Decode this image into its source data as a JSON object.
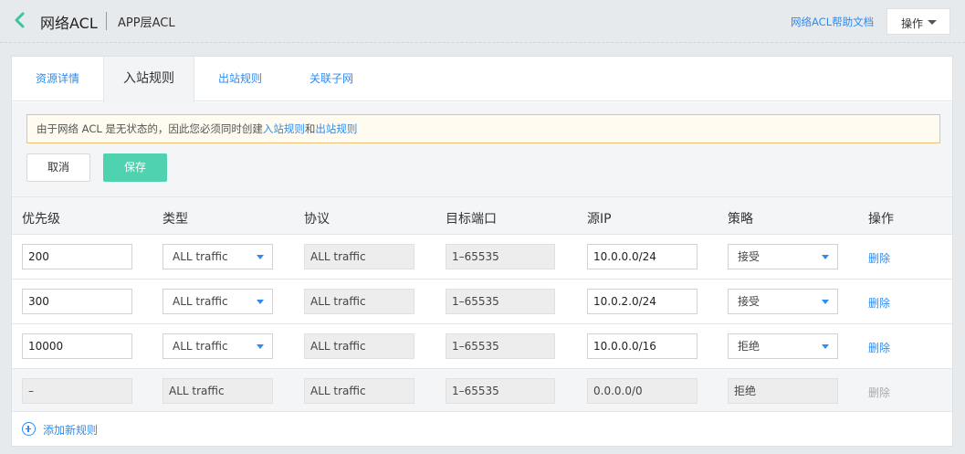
{
  "header": {
    "title": "网络ACL",
    "subtitle": "APP层ACL",
    "help_link": "网络ACL帮助文档",
    "ops_label": "操作"
  },
  "tabs": [
    {
      "label": "资源详情"
    },
    {
      "label": "入站规则"
    },
    {
      "label": "出站规则"
    },
    {
      "label": "关联子网"
    }
  ],
  "active_tab": "入站规则",
  "notice": {
    "prefix": "由于网络 ACL 是无状态的，因此您必须同时创建",
    "link1": "入站规则",
    "middle": "和",
    "link2": "出站规则"
  },
  "buttons": {
    "cancel": "取消",
    "save": "保存"
  },
  "columns": [
    "优先级",
    "类型",
    "协议",
    "目标端口",
    "源IP",
    "策略",
    "操作"
  ],
  "rows": [
    {
      "priority": "200",
      "type": "ALL traffic",
      "protocol": "ALL traffic",
      "port": "1–65535",
      "source_ip": "10.0.0.0/24",
      "policy": "接受",
      "action": "删除"
    },
    {
      "priority": "300",
      "type": "ALL traffic",
      "protocol": "ALL traffic",
      "port": "1–65535",
      "source_ip": "10.0.2.0/24",
      "policy": "接受",
      "action": "删除"
    },
    {
      "priority": "10000",
      "type": "ALL traffic",
      "protocol": "ALL traffic",
      "port": "1–65535",
      "source_ip": "10.0.0.0/16",
      "policy": "拒绝",
      "action": "删除"
    },
    {
      "priority": "–",
      "type": "ALL traffic",
      "protocol": "ALL traffic",
      "port": "1–65535",
      "source_ip": "0.0.0.0/0",
      "policy": "拒绝",
      "action": "删除"
    }
  ],
  "add_rule_label": "添加新规则",
  "colors": {
    "accent": "#2d8cf0",
    "save": "#4fd2b0",
    "back": "#3cc3a3",
    "notice_border": "#f3c173"
  }
}
